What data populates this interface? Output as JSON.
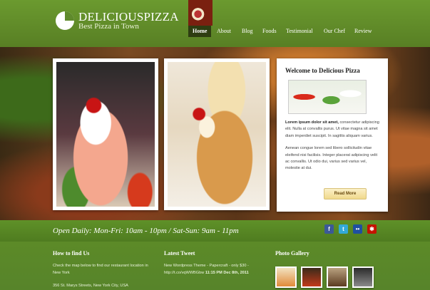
{
  "brand": {
    "title": "DELICIOUSPIZZA",
    "subtitle": "Best Pizza in Town"
  },
  "nav": [
    {
      "label": "Home",
      "active": true
    },
    {
      "label": "About"
    },
    {
      "label": "Blog"
    },
    {
      "label": "Foods"
    },
    {
      "label": "Testimonial"
    },
    {
      "label": "Our Chef"
    },
    {
      "label": "Review"
    }
  ],
  "welcome": {
    "title": "Welcome to Delicious Pizza",
    "para1_bold": "Lorem ipsum dolor sit amet,",
    "para1": " consectetur adipiscing elit. Nulla at convallis purus. Ut vitae magna sit amet diam imperdiet suscipit. In sagittis aliquam varius.",
    "para2": "Aenean congue lorem sed libero sollicitudin vitae eleifend nisi facilisis. Integer placerat adipiscing velit ac convallis. Ut odio dui, varius sed varius vel, molestie at dui.",
    "button": "Read More"
  },
  "hours": "Open Daily: Mon-Fri: 10am - 10pm / Sat-Sun: 9am - 11pm",
  "social": [
    {
      "name": "facebook-icon",
      "glyph": "f",
      "color": "#3b5998"
    },
    {
      "name": "twitter-icon",
      "glyph": "t",
      "color": "#33a9d8"
    },
    {
      "name": "flickr-icon",
      "glyph": "••",
      "color": "#1f4fa0"
    },
    {
      "name": "yelp-icon",
      "glyph": "✱",
      "color": "#c41200"
    }
  ],
  "footer": {
    "find_title": "How to find Us",
    "find_text": "Check the map below to find our restaurant location in New York",
    "address": "356 St. Marys Streets, New York City, USA",
    "tweet_title": "Latest Tweet",
    "tweet_text": "New Wordpress Theme - Papercraft - only $30 - http://t.co/vqWWBGbw",
    "tweet_time": "11:15 PM Dec 8th, 2011",
    "gallery_title": "Photo Gallery"
  },
  "colors": {
    "accent": "#5f8a2c",
    "nav_active": "#2e3d12"
  }
}
